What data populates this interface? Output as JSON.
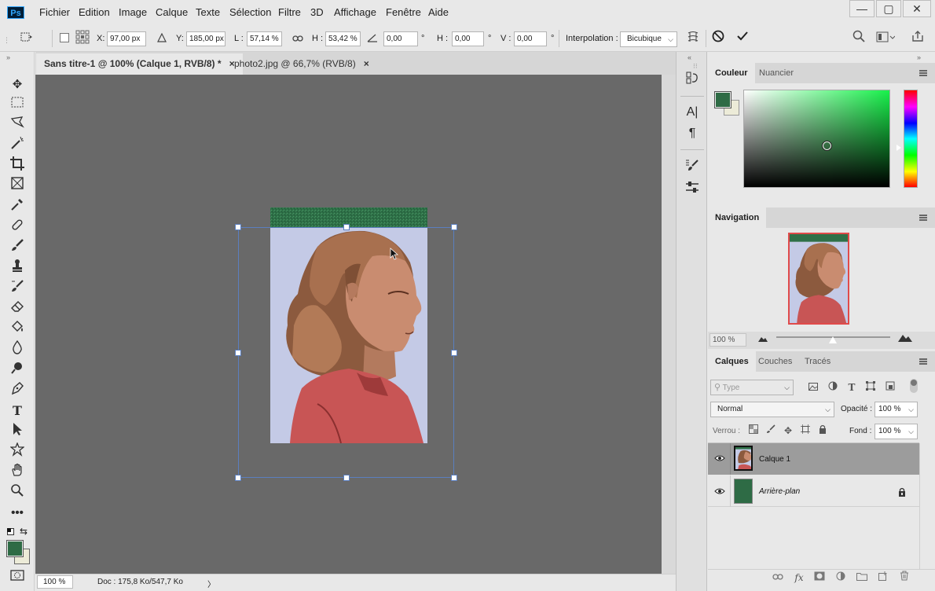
{
  "app": {
    "logo": "Ps"
  },
  "menu": [
    "Fichier",
    "Edition",
    "Image",
    "Calque",
    "Texte",
    "Sélection",
    "Filtre",
    "3D",
    "Affichage",
    "Fenêtre",
    "Aide"
  ],
  "window_controls": {
    "minimize": "—",
    "restore": "▢",
    "close": "✕"
  },
  "options": {
    "x_label": "X:",
    "x_value": "97,00 px",
    "y_label": "Y:",
    "y_value": "185,00 px",
    "w_label": "L :",
    "w_value": "57,14 %",
    "h_label": "H :",
    "h_value": "53,42 %",
    "angle_value": "0,00",
    "deg": "°",
    "hskew_label": "H :",
    "hskew_value": "0,00",
    "vskew_label": "V :",
    "vskew_value": "0,00",
    "interp_label": "Interpolation :",
    "interp_value": "Bicubique"
  },
  "tabs": [
    {
      "label": "Sans titre-1 @ 100% (Calque 1, RVB/8) *",
      "close": "×"
    },
    {
      "label": "photo2.jpg @ 66,7% (RVB/8)",
      "close": "×"
    }
  ],
  "status": {
    "zoom": "100 %",
    "doc": "Doc : 175,8 Ko/547,7 Ko",
    "arrow": "〉"
  },
  "color_panel": {
    "tabs": [
      "Couleur",
      "Nuancier"
    ],
    "foreground": "#2e6b45",
    "background": "#ecebd8"
  },
  "navigation_panel": {
    "title": "Navigation",
    "zoom": "100 %"
  },
  "layers_panel": {
    "tabs": [
      "Calques",
      "Couches",
      "Tracés"
    ],
    "search_placeholder": "Type",
    "blend_mode": "Normal",
    "opacity_label": "Opacité :",
    "opacity_value": "100 %",
    "lock_label": "Verrou :",
    "fill_label": "Fond :",
    "fill_value": "100 %",
    "layers": [
      {
        "name": "Calque 1",
        "selected": true
      },
      {
        "name": "Arrière-plan",
        "locked": true
      }
    ]
  },
  "colors": {
    "accent": "#2e6b45",
    "selection": "#5b7fbf",
    "canvas_bg": "#696969"
  }
}
